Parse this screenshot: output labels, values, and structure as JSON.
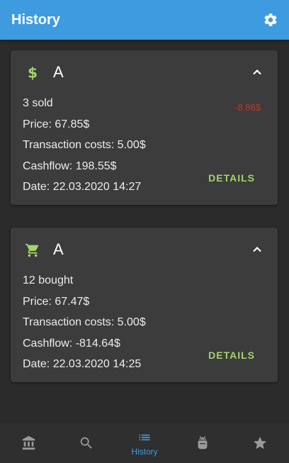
{
  "appbar": {
    "title": "History",
    "settings_icon": "gear-icon"
  },
  "colors": {
    "primary": "#3f9be0",
    "background": "#2b2b2b",
    "card": "#3c3c3c",
    "accent_green": "#a5d36a",
    "negative_red": "#c0392b",
    "nav_inactive": "#9a9a9a"
  },
  "transactions": [
    {
      "type_icon": "dollar-icon",
      "title": "A",
      "quantity_text": "3 sold",
      "change": "-8.86$",
      "price": "Price: 67.85$",
      "costs": "Transaction costs: 5.00$",
      "cashflow": "Cashflow: 198.55$",
      "date": "Date: 22.03.2020 14:27",
      "details_label": "DETAILS"
    },
    {
      "type_icon": "cart-icon",
      "title": "A",
      "quantity_text": "12 bought",
      "price": "Price: 67.47$",
      "costs": "Transaction costs: 5.00$",
      "cashflow": "Cashflow: -814.64$",
      "date": "Date: 22.03.2020 14:25",
      "details_label": "DETAILS"
    }
  ],
  "bottom_nav": {
    "items": [
      {
        "icon": "bank-icon",
        "label": ""
      },
      {
        "icon": "search-icon",
        "label": ""
      },
      {
        "icon": "list-icon",
        "label": "History",
        "active": true
      },
      {
        "icon": "android-icon",
        "label": ""
      },
      {
        "icon": "star-icon",
        "label": ""
      }
    ]
  }
}
